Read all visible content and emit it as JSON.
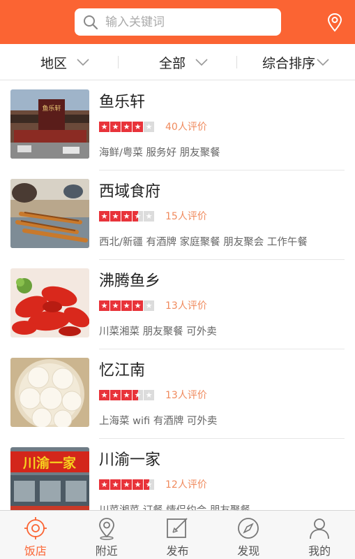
{
  "search": {
    "placeholder": "输入关键词"
  },
  "filters": [
    {
      "label": "地区"
    },
    {
      "label": "全部"
    },
    {
      "label": "综合排序"
    }
  ],
  "restaurants": [
    {
      "name": "鱼乐轩",
      "rating": 4,
      "reviews": "40人评价",
      "tags": "海鲜/粤菜 服务好 朋友聚餐"
    },
    {
      "name": "西域食府",
      "rating": 3.5,
      "reviews": "15人评价",
      "tags": "西北/新疆 有酒牌 家庭聚餐 朋友聚会 工作午餐"
    },
    {
      "name": "沸腾鱼乡",
      "rating": 4,
      "reviews": "13人评价",
      "tags": "川菜湘菜 朋友聚餐 可外卖"
    },
    {
      "name": "忆江南",
      "rating": 3.5,
      "reviews": "13人评价",
      "tags": "上海菜 wifi 有酒牌 可外卖"
    },
    {
      "name": "川渝一家",
      "rating": 4.5,
      "reviews": "12人评价",
      "tags": "川菜湘菜 订餐 情侣约会 朋友聚餐"
    }
  ],
  "thumb_signs": {
    "shop1": "鱼乐轩",
    "shop5": "川渝一家"
  },
  "nav": [
    {
      "label": "饭店",
      "icon": "restaurant-icon",
      "active": true
    },
    {
      "label": "附近",
      "icon": "nearby-pin-icon",
      "active": false
    },
    {
      "label": "发布",
      "icon": "post-edit-icon",
      "active": false
    },
    {
      "label": "发现",
      "icon": "discover-compass-icon",
      "active": false
    },
    {
      "label": "我的",
      "icon": "profile-user-icon",
      "active": false
    }
  ],
  "colors": {
    "brand": "#fb6433",
    "star": "#e8333a",
    "review": "#f08a5d"
  }
}
